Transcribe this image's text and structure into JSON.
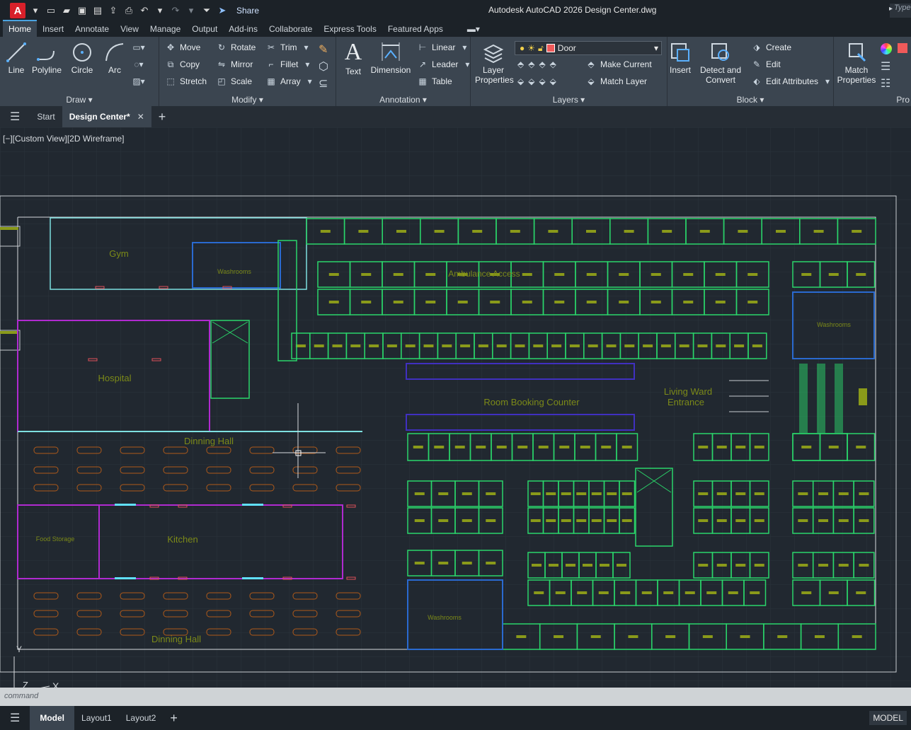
{
  "titlebar": {
    "app_initial": "A",
    "share_label": "Share",
    "title": "Autodesk AutoCAD 2026   Design Center.dwg",
    "search_placeholder": "Type"
  },
  "ribbon_tabs": [
    "Home",
    "Insert",
    "Annotate",
    "View",
    "Manage",
    "Output",
    "Add-ins",
    "Collaborate",
    "Express Tools",
    "Featured Apps"
  ],
  "ribbon": {
    "draw": {
      "label": "Draw",
      "line": "Line",
      "polyline": "Polyline",
      "circle": "Circle",
      "arc": "Arc"
    },
    "modify": {
      "label": "Modify",
      "move": "Move",
      "rotate": "Rotate",
      "trim": "Trim",
      "copy": "Copy",
      "mirror": "Mirror",
      "fillet": "Fillet",
      "stretch": "Stretch",
      "scale": "Scale",
      "array": "Array"
    },
    "annotation": {
      "label": "Annotation",
      "text": "Text",
      "dimension": "Dimension",
      "linear": "Linear",
      "leader": "Leader",
      "table": "Table"
    },
    "layers": {
      "label": "Layers",
      "layer_properties": "Layer Properties",
      "current_layer": "Door",
      "make_current": "Make Current",
      "match_layer": "Match Layer"
    },
    "block": {
      "label": "Block",
      "insert": "Insert",
      "detect_convert": "Detect and Convert",
      "create": "Create",
      "edit": "Edit",
      "edit_attributes": "Edit Attributes"
    },
    "properties": {
      "match_properties": "Match Properties",
      "label": "Pro"
    }
  },
  "doc_tabs": {
    "start": "Start",
    "active": "Design Center*"
  },
  "viewport": {
    "label": "[−][Custom View][2D Wireframe]",
    "rooms": {
      "gym": "Gym",
      "washrooms_1": "Washrooms",
      "ambulance": "Ambulance Access",
      "washrooms_2": "Washrooms",
      "hospital": "Hospital",
      "room_booking": "Room Booking Counter",
      "living_ward": "Living Ward",
      "entrance": "Entrance",
      "dinning_hall_1": "Dinning Hall",
      "food_storage": "Food Storage",
      "kitchen": "Kitchen",
      "washrooms_3": "Washrooms",
      "dinning_hall_2": "Dinning Hall"
    },
    "ucs_x": "X",
    "ucs_y": "Y",
    "ucs_z": "Z"
  },
  "command": {
    "prompt": "command"
  },
  "status": {
    "model": "Model",
    "layout1": "Layout1",
    "layout2": "Layout2",
    "mode": "MODEL"
  },
  "colors": {
    "room_green": "#2ad56a",
    "bed_olive": "#8a9a1a",
    "door_red": "#e0505a",
    "label_olive": "#7c8a18",
    "purple": "#b02ad0",
    "blue": "#2a6ad0",
    "table_orange": "#b05a1a",
    "accent": "#4aa3df"
  }
}
